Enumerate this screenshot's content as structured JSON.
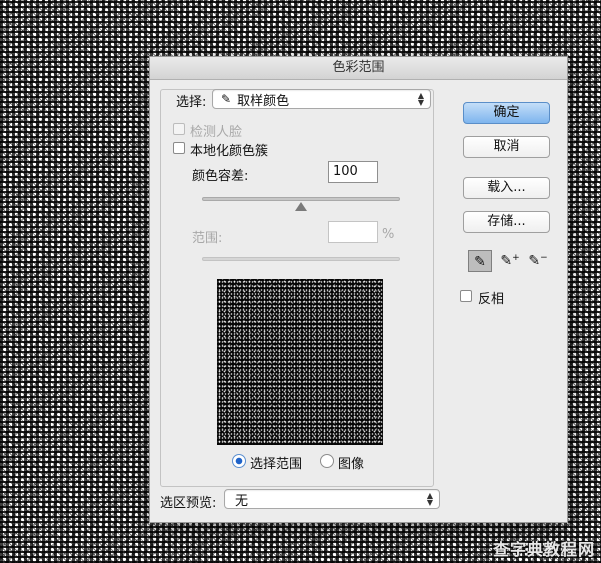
{
  "dialog": {
    "title": "色彩范围",
    "select_label": "选择:",
    "select_icon": "eyedropper-icon",
    "select_value": "取样颜色",
    "detect_faces_label": "检测人脸",
    "localized_label": "本地化颜色簇",
    "fuzziness_label": "颜色容差:",
    "fuzziness_value": "100",
    "fuzziness_slider_percent": 50,
    "range_label": "范围:",
    "range_value": "",
    "range_unit": "%",
    "range_slider_percent": 0,
    "radio_selection_label": "选择范围",
    "radio_image_label": "图像",
    "preview_label": "选区预览:",
    "preview_value": "无"
  },
  "buttons": {
    "ok": "确定",
    "cancel": "取消",
    "load": "载入...",
    "save": "存储..."
  },
  "tools": {
    "eyedropper": "eyedropper-icon",
    "add": "eyedropper-plus-icon",
    "subtract": "eyedropper-minus-icon"
  },
  "invert_label": "反相",
  "watermark": "查字典教程网"
}
